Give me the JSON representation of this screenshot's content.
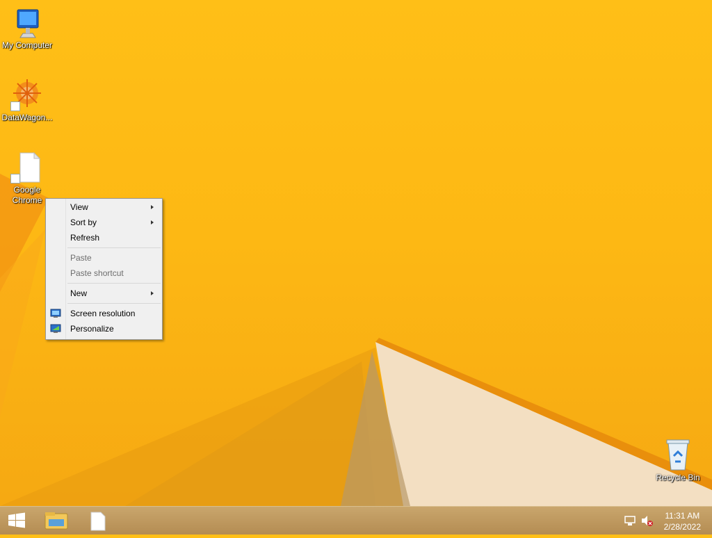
{
  "desktop": {
    "icons": [
      {
        "label": "My Computer"
      },
      {
        "label": "DataWagon..."
      },
      {
        "label": "Google Chrome",
        "line1": "Google",
        "line2": "Chrome"
      },
      {
        "label": "Recycle Bin"
      }
    ]
  },
  "context_menu": {
    "items": [
      {
        "label": "View",
        "submenu": true
      },
      {
        "label": "Sort by",
        "submenu": true
      },
      {
        "label": "Refresh"
      },
      {
        "label": "Paste",
        "disabled": true
      },
      {
        "label": "Paste shortcut",
        "disabled": true
      },
      {
        "label": "New",
        "submenu": true
      },
      {
        "label": "Screen resolution",
        "icon": "display-icon"
      },
      {
        "label": "Personalize",
        "icon": "personalize-icon"
      }
    ]
  },
  "taskbar": {
    "start_icon": "windows-start-icon",
    "pinned": [
      {
        "icon": "file-explorer-icon"
      },
      {
        "icon": "blank-document-icon"
      }
    ],
    "tray": [
      {
        "icon": "network-icon"
      },
      {
        "icon": "volume-muted-icon"
      }
    ],
    "clock": {
      "time": "11:31 AM",
      "date": "2/28/2022"
    }
  },
  "colors": {
    "wallpaper": "#fdb814",
    "taskbar": "#b48c52",
    "menu_bg": "#f0f0f0",
    "disabled_text": "#6d6d6d"
  }
}
